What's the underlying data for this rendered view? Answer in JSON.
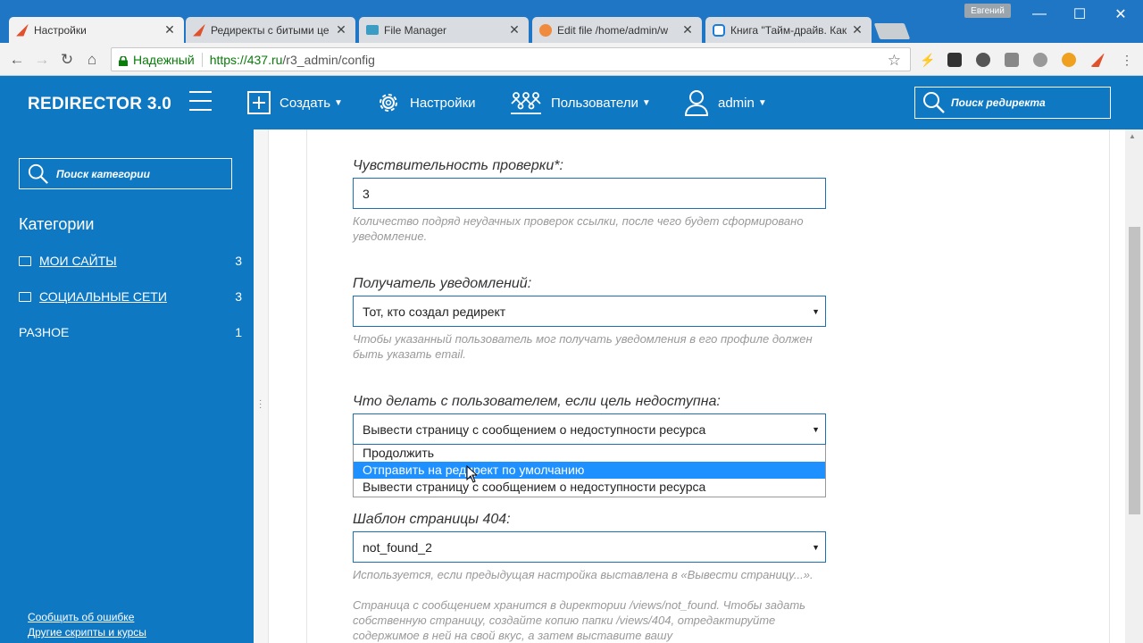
{
  "browser": {
    "tabs": [
      {
        "title": "Настройки",
        "icon_color": "#e0522c",
        "active": true
      },
      {
        "title": "Редиректы с битыми це",
        "icon_color": "#e0522c",
        "active": false
      },
      {
        "title": "File Manager",
        "icon_color": "#3b9cc4",
        "active": false
      },
      {
        "title": "Edit file /home/admin/w",
        "icon_color": "#f08a3c",
        "active": false
      },
      {
        "title": "Книга \"Тайм-драйв. Как",
        "icon_color": "#1a7ed8",
        "active": false
      }
    ],
    "user_badge": "Евгений",
    "window_controls": {
      "minimize": "—",
      "maximize": "☐",
      "close": "✕"
    },
    "secure_label": "Надежный",
    "url_host": "https://437.ru",
    "url_path": "/r3_admin/config"
  },
  "header": {
    "logo": "REDIRECTOR 3.0",
    "create_label": "Создать",
    "settings_label": "Настройки",
    "users_label": "Пользователи",
    "admin_label": "admin",
    "search_placeholder": "Поиск редиректа"
  },
  "sidebar": {
    "search_placeholder": "Поиск категории",
    "categories_title": "Категории",
    "categories": [
      {
        "label": "МОИ САЙТЫ",
        "count": "3"
      },
      {
        "label": "СОЦИАЛЬНЫЕ СЕТИ",
        "count": "3"
      },
      {
        "label": "РАЗНОЕ",
        "count": "1"
      }
    ],
    "report_bug": "Сообщить об ошибке",
    "other_scripts": "Другие скрипты и курсы"
  },
  "form": {
    "sensitivity": {
      "label": "Чувствительность проверки*:",
      "value": "3",
      "hint": "Количество подряд неудачных проверок ссылки, после чего будет сформировано уведомление."
    },
    "recipient": {
      "label": "Получатель уведомлений:",
      "value": "Тот, кто создал редирект",
      "hint": "Чтобы указанный пользователь мог получать уведомления в его профиле должен быть указать email."
    },
    "unavailable_action": {
      "label": "Что делать с пользователем, если цель недоступна:",
      "value": "Вывести страницу с сообщением о недоступности ресурса",
      "options": [
        "Продолжить",
        "Отправить на редирект по умолчанию",
        "Вывести страницу с сообщением о недоступности ресурса"
      ],
      "highlighted_option": "Отправить на редирект по умолчанию"
    },
    "template404": {
      "label": "Шаблон страницы 404:",
      "value": "not_found_2",
      "hint1": "Используется, если предыдущая настройка выставлена в «Вывести страницу...».",
      "hint2": "Страница с сообщением хранится в директории /views/not_found. Чтобы задать собственную страницу, создайте копию папки /views/404, отредактируйте содержимое в ней на свой вкус, а затем выставите вашу"
    }
  },
  "colors": {
    "brand_blue": "#0f78c3",
    "input_border": "#1f6fb5",
    "highlight": "#1e90ff"
  }
}
